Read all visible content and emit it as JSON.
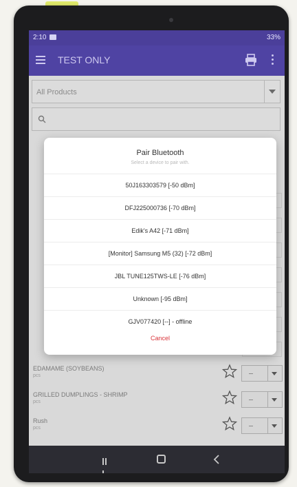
{
  "status_bar": {
    "time": "2:10",
    "right": "33%"
  },
  "app_bar": {
    "title": "TEST ONLY"
  },
  "filter": {
    "selected": "All Products"
  },
  "search": {
    "placeholder": ""
  },
  "products": [
    {
      "name": "EDAMAME (SOYBEANS)",
      "sub": "pcs"
    },
    {
      "name": "GRILLED DUMPLINGS - SHRIMP",
      "sub": "pcs"
    },
    {
      "name": "Rush",
      "sub": "pcs"
    }
  ],
  "dialog": {
    "title": "Pair Bluetooth",
    "subtitle": "Select a device to pair with.",
    "devices": [
      "50J163303579 [-50 dBm]",
      "DFJ225000736 [-70 dBm]",
      "Edik's A42 [-71 dBm]",
      "[Monitor] Samsung M5 (32) [-72 dBm]",
      "JBL TUNE125TWS-LE [-76 dBm]",
      "Unknown [-95 dBm]",
      "GJV077420 [--] - offline"
    ],
    "cancel": "Cancel"
  },
  "colors": {
    "app_bar": "#4f43a3",
    "cancel": "#d9343a"
  }
}
